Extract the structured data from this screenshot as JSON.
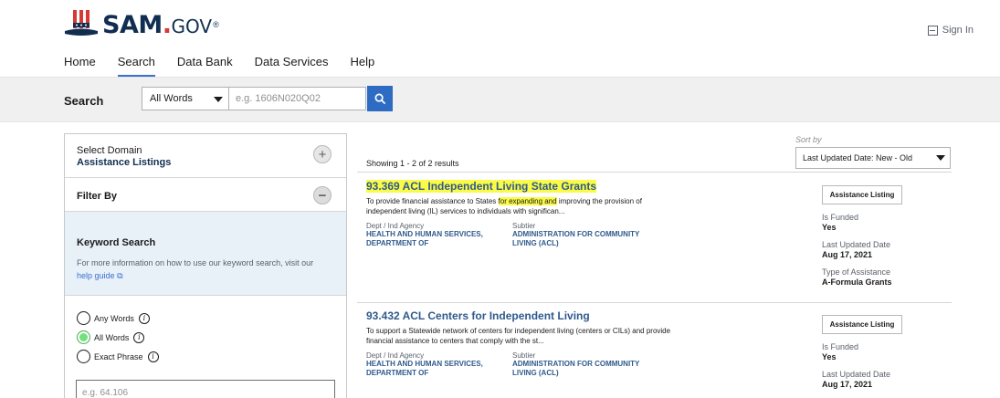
{
  "header": {
    "logo_main": "SAM",
    "logo_dot": ".",
    "logo_gov": "GOV",
    "logo_reg": "®",
    "sign_in": "Sign In"
  },
  "nav": [
    {
      "label": "Home"
    },
    {
      "label": "Search",
      "active": true
    },
    {
      "label": "Data Bank"
    },
    {
      "label": "Data Services"
    },
    {
      "label": "Help"
    }
  ],
  "searchbar": {
    "label": "Search",
    "mode": "All Words",
    "placeholder": "e.g. 1606N020Q02"
  },
  "left_panel": {
    "domain_label": "Select Domain",
    "domain_value": "Assistance Listings",
    "filter_by": "Filter By",
    "keyword_title": "Keyword Search",
    "keyword_desc": "For more information on how to use our keyword search, visit our",
    "keyword_link": "help guide",
    "radios": [
      {
        "label": "Any Words",
        "selected": false
      },
      {
        "label": "All Words",
        "selected": true
      },
      {
        "label": "Exact Phrase",
        "selected": false
      }
    ],
    "keyword_placeholder": "e.g. 64.106"
  },
  "results": {
    "showing": "Showing 1 - 2 of 2 results",
    "sort_label": "Sort by",
    "sort_value": "Last Updated Date: New - Old",
    "items": [
      {
        "title": "93.369 ACL Independent Living State Grants",
        "desc_pre": "To provide financial assistance to States ",
        "desc_hl": "for expanding and",
        "desc_post": " improving the provision of independent living (IL) services to individuals with significan...",
        "dept_label": "Dept / Ind Agency",
        "dept_value": "HEALTH AND HUMAN SERVICES, DEPARTMENT OF",
        "subtier_label": "Subtier",
        "subtier_value": "ADMINISTRATION FOR COMMUNITY LIVING (ACL)",
        "badge": "Assistance Listing",
        "funded_label": "Is Funded",
        "funded_value": "Yes",
        "updated_label": "Last Updated Date",
        "updated_value": "Aug 17, 2021",
        "type_label": "Type of Assistance",
        "type_value": "A-Formula Grants"
      },
      {
        "title": "93.432 ACL Centers for Independent Living",
        "desc": "To support a Statewide network of centers for independent living (centers or CILs) and provide financial assistance to centers that comply with the st...",
        "dept_label": "Dept / Ind Agency",
        "dept_value": "HEALTH AND HUMAN SERVICES, DEPARTMENT OF",
        "subtier_label": "Subtier",
        "subtier_value": "ADMINISTRATION FOR COMMUNITY LIVING (ACL)",
        "badge": "Assistance Listing",
        "funded_label": "Is Funded",
        "funded_value": "Yes",
        "updated_label": "Last Updated Date",
        "updated_value": "Aug 17, 2021"
      }
    ]
  },
  "colors": {
    "brand_navy": "#112e51",
    "brand_red": "#d83933",
    "link_blue": "#2f5a8c",
    "button_blue": "#2e6cc4",
    "highlight": "#fafa48"
  }
}
